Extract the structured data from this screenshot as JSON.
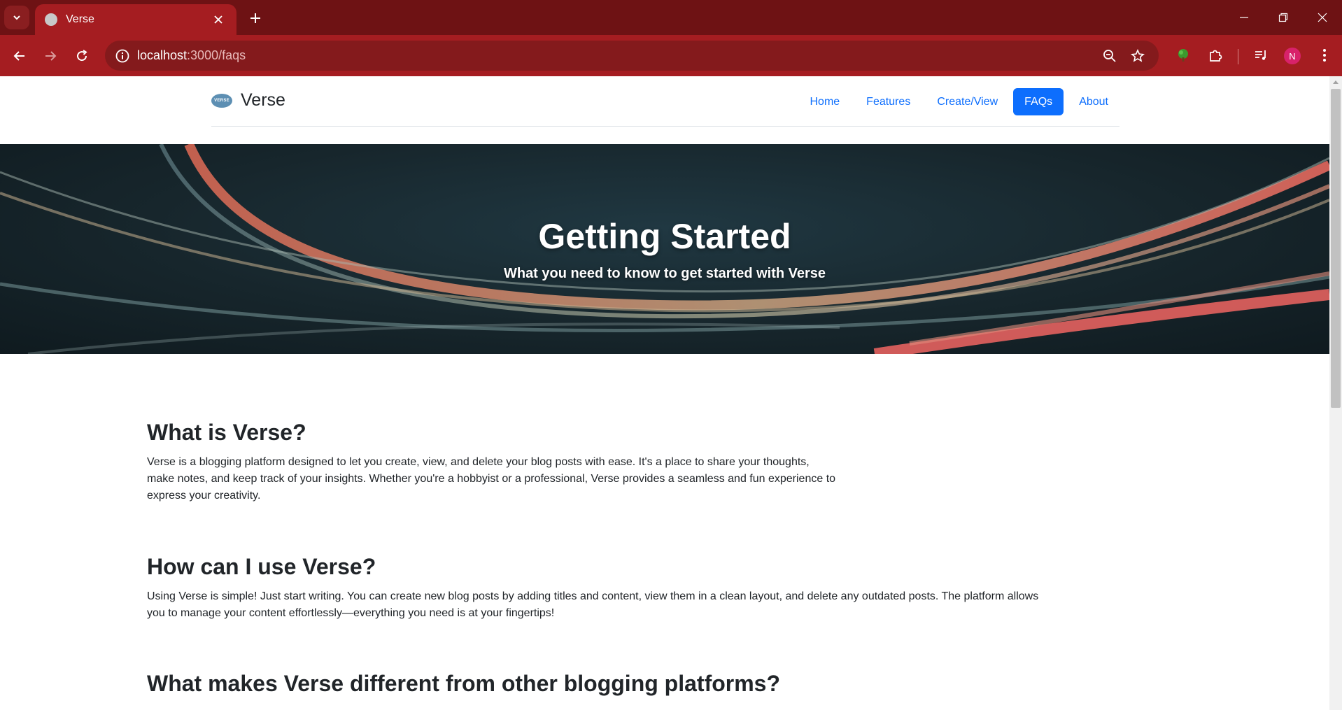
{
  "browser": {
    "tab_title": "Verse",
    "url_host": "localhost",
    "url_rest": ":3000/faqs",
    "avatar_letter": "N",
    "accent_color": "#a51d21"
  },
  "site": {
    "brand_name": "Verse",
    "logo_text": "VERSE",
    "nav": [
      {
        "label": "Home",
        "active": false
      },
      {
        "label": "Features",
        "active": false
      },
      {
        "label": "Create/View",
        "active": false
      },
      {
        "label": "FAQs",
        "active": true
      },
      {
        "label": "About",
        "active": false
      }
    ],
    "primary_color": "#0d6efd"
  },
  "hero": {
    "title": "Getting Started",
    "subtitle": "What you need to know to get started with Verse"
  },
  "faqs": [
    {
      "question": "What is Verse?",
      "answer": "Verse is a blogging platform designed to let you create, view, and delete your blog posts with ease. It's a place to share your thoughts, make notes, and keep track of your insights. Whether you're a hobbyist or a professional, Verse provides a seamless and fun experience to express your creativity."
    },
    {
      "question": "How can I use Verse?",
      "answer": "Using Verse is simple! Just start writing. You can create new blog posts by adding titles and content, view them in a clean layout, and delete any outdated posts. The platform allows you to manage your content effortlessly—everything you need is at your fingertips!"
    },
    {
      "question": "What makes Verse different from other blogging platforms?",
      "answer": ""
    }
  ]
}
